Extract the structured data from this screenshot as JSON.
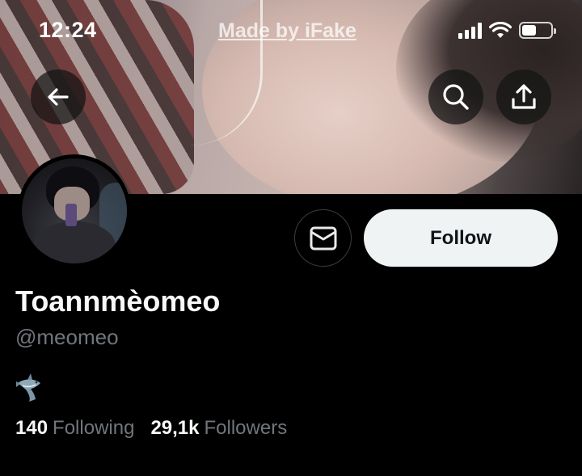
{
  "status_bar": {
    "time": "12:24",
    "watermark": "Made by iFake"
  },
  "banner": {
    "image": "cover-photo"
  },
  "header_buttons": {
    "back_icon": "arrow-left-icon",
    "search_icon": "search-icon",
    "share_icon": "share-upload-icon"
  },
  "profile": {
    "display_name": "Toannmèomeo",
    "handle": "@meomeo",
    "bio_emoji": "shark-icon",
    "follow_label": "Follow",
    "message_icon": "envelope-icon"
  },
  "stats": {
    "following_count": "140",
    "following_label": "Following",
    "followers_count": "29,1k",
    "followers_label": "Followers"
  },
  "colors": {
    "background": "#000000",
    "primary_text": "#f7f9f9",
    "secondary_text": "#71767b",
    "follow_bg": "#eff3f4",
    "follow_text": "#0f1419"
  }
}
